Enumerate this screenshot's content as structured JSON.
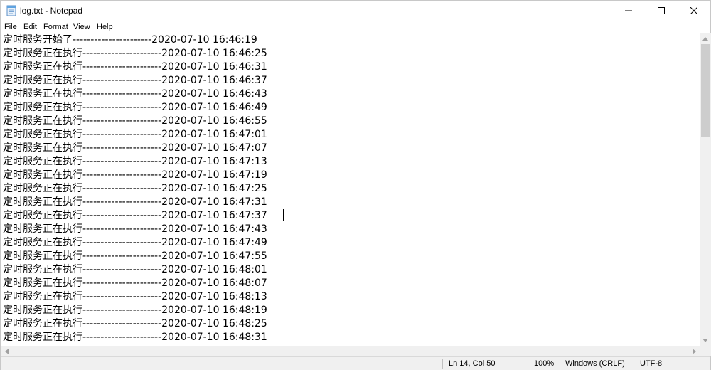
{
  "window": {
    "title": "log.txt - Notepad"
  },
  "menu": {
    "items": [
      "File",
      "Edit",
      "Format",
      "View",
      "Help"
    ]
  },
  "editor": {
    "lines": [
      "定时服务开始了----------------------2020-07-10 16:46:19",
      "定时服务正在执行----------------------2020-07-10 16:46:25",
      "定时服务正在执行----------------------2020-07-10 16:46:31",
      "定时服务正在执行----------------------2020-07-10 16:46:37",
      "定时服务正在执行----------------------2020-07-10 16:46:43",
      "定时服务正在执行----------------------2020-07-10 16:46:49",
      "定时服务正在执行----------------------2020-07-10 16:46:55",
      "定时服务正在执行----------------------2020-07-10 16:47:01",
      "定时服务正在执行----------------------2020-07-10 16:47:07",
      "定时服务正在执行----------------------2020-07-10 16:47:13",
      "定时服务正在执行----------------------2020-07-10 16:47:19",
      "定时服务正在执行----------------------2020-07-10 16:47:25",
      "定时服务正在执行----------------------2020-07-10 16:47:31",
      "定时服务正在执行----------------------2020-07-10 16:47:37",
      "定时服务正在执行----------------------2020-07-10 16:47:43",
      "定时服务正在执行----------------------2020-07-10 16:47:49",
      "定时服务正在执行----------------------2020-07-10 16:47:55",
      "定时服务正在执行----------------------2020-07-10 16:48:01",
      "定时服务正在执行----------------------2020-07-10 16:48:07",
      "定时服务正在执行----------------------2020-07-10 16:48:13",
      "定时服务正在执行----------------------2020-07-10 16:48:19",
      "定时服务正在执行----------------------2020-07-10 16:48:25",
      "定时服务正在执行----------------------2020-07-10 16:48:31"
    ]
  },
  "status": {
    "position": "Ln 14, Col 50",
    "zoom": "100%",
    "line_ending": "Windows (CRLF)",
    "encoding": "UTF-8"
  },
  "icons": {
    "app": "notepad-icon",
    "minimize": "minimize-icon",
    "maximize": "maximize-icon",
    "close": "close-icon"
  }
}
